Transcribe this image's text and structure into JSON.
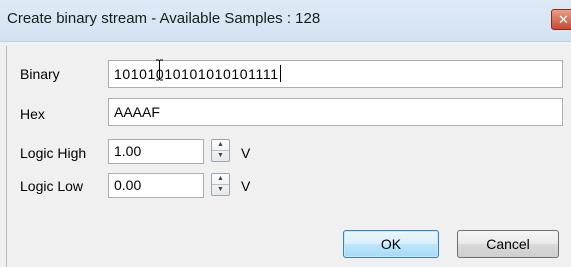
{
  "dialog": {
    "title": "Create binary stream - Available Samples : 128",
    "close_glyph": "✕"
  },
  "fields": {
    "binary": {
      "label": "Binary",
      "value": "10101010101010101111"
    },
    "hex": {
      "label": "Hex",
      "value": "AAAAF"
    },
    "logic_high": {
      "label": "Logic High",
      "value": "1.00",
      "unit": "V"
    },
    "logic_low": {
      "label": "Logic Low",
      "value": "0.00",
      "unit": "V"
    }
  },
  "buttons": {
    "ok": "OK",
    "cancel": "Cancel"
  },
  "icons": {
    "spin_up": "▲",
    "spin_down": "▼"
  },
  "colors": {
    "titlebar": "#d8e5f3",
    "dialog_bg": "#f0f0f0",
    "ok_accent": "#3c7fb1",
    "close_button": "#c64a31"
  }
}
